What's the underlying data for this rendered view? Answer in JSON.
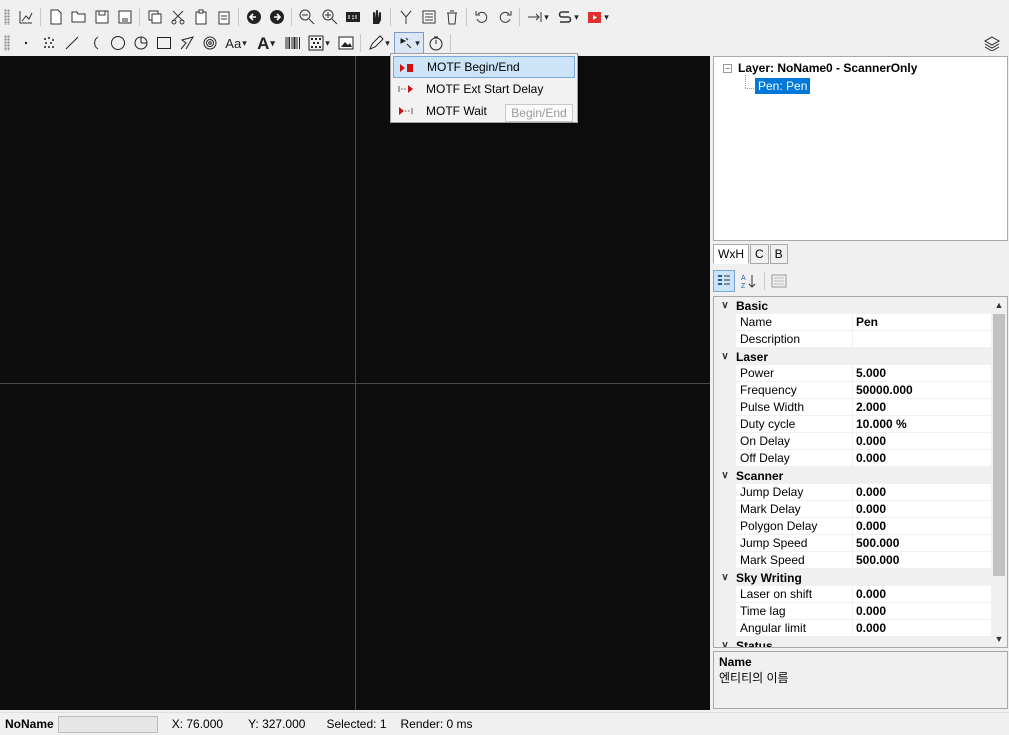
{
  "menu": {
    "items": [
      {
        "label": "MOTF Begin/End",
        "icon": "motf-begin-end-icon"
      },
      {
        "label": "MOTF Ext Start Delay",
        "icon": "motf-ext-start-delay-icon"
      },
      {
        "label": "MOTF Wait",
        "icon": "motf-wait-icon"
      }
    ],
    "tooltip": "Begin/End"
  },
  "tree": {
    "root": "Layer: NoName0 - ScannerOnly",
    "expander": "−",
    "child": "Pen: Pen"
  },
  "tabs": [
    "WxH",
    "C",
    "B"
  ],
  "properties": {
    "basic": {
      "category": "Basic",
      "name_label": "Name",
      "name_value": "Pen",
      "description_label": "Description",
      "description_value": ""
    },
    "laser": {
      "category": "Laser",
      "power_label": "Power",
      "power_value": "5.000",
      "frequency_label": "Frequency",
      "frequency_value": "50000.000",
      "pulse_width_label": "Pulse Width",
      "pulse_width_value": "2.000",
      "duty_cycle_label": "Duty cycle",
      "duty_cycle_value": "10.000 %",
      "on_delay_label": "On Delay",
      "on_delay_value": "0.000",
      "off_delay_label": "Off Delay",
      "off_delay_value": "0.000"
    },
    "scanner": {
      "category": "Scanner",
      "jump_delay_label": "Jump Delay",
      "jump_delay_value": "0.000",
      "mark_delay_label": "Mark Delay",
      "mark_delay_value": "0.000",
      "polygon_delay_label": "Polygon Delay",
      "polygon_delay_value": "0.000",
      "jump_speed_label": "Jump Speed",
      "jump_speed_value": "500.000",
      "mark_speed_label": "Mark Speed",
      "mark_speed_value": "500.000"
    },
    "sky_writing": {
      "category": "Sky Writing",
      "laser_on_shift_label": "Laser on shift",
      "laser_on_shift_value": "0.000",
      "time_lag_label": "Time lag",
      "time_lag_value": "0.000",
      "angular_limit_label": "Angular limit",
      "angular_limit_value": "0.000"
    },
    "status": {
      "category": "Status"
    }
  },
  "help": {
    "title": "Name",
    "text": "엔티티의 이름"
  },
  "status_bar": {
    "document": "NoName",
    "x": "X: 76.000",
    "y": "Y: 327.000",
    "selected": "Selected: 1",
    "render": "Render: 0 ms"
  },
  "colors": {
    "canvas_bg": "#0d0d0d",
    "selection": "#0078d7",
    "motf_red": "#cc1111"
  }
}
